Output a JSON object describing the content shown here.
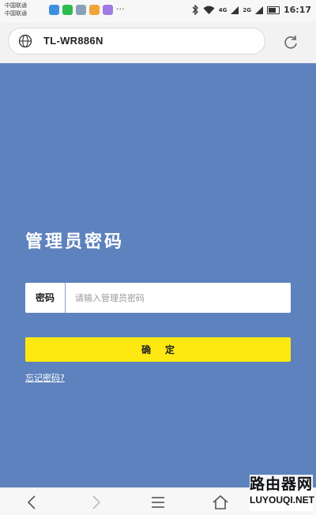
{
  "status_bar": {
    "carrier_1": "中国联通",
    "carrier_2": "中国联通",
    "app_icons": [
      {
        "name": "app1-icon",
        "color": "#3d8fe0"
      },
      {
        "name": "wechat-icon",
        "color": "#2dbb4e"
      },
      {
        "name": "gallery-icon",
        "color": "#8aa0b8"
      },
      {
        "name": "app4-icon",
        "color": "#f2a33a"
      },
      {
        "name": "app5-icon",
        "color": "#a07ae0"
      }
    ],
    "more": "···",
    "net_1": "4G",
    "net_2": "2G",
    "time": "16:17"
  },
  "address_bar": {
    "url": "TL-WR886N"
  },
  "login": {
    "title": "管理员密码",
    "password_label": "密码",
    "password_placeholder": "请输入管理员密码",
    "password_value": "",
    "confirm_label": "确定",
    "forgot_link": "忘记密码?"
  },
  "watermark": {
    "cn": "路由器网",
    "en": "LUYOUQI.NET"
  },
  "colors": {
    "main_bg": "#5e82bd",
    "button_bg": "#fde811"
  }
}
